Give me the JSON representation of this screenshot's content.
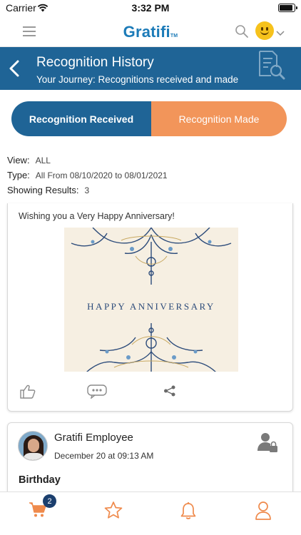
{
  "status_bar": {
    "carrier": "Carrier",
    "time": "3:32 PM"
  },
  "header": {
    "logo_text": "Gratifi",
    "logo_tm": "TM",
    "icons": [
      "menu-icon",
      "search-icon",
      "smiley-icon",
      "chevron-down-icon"
    ]
  },
  "banner": {
    "title": "Recognition History",
    "subtitle": "Your Journey: Recognitions received and made",
    "icons": [
      "back-icon",
      "document-search-icon"
    ]
  },
  "tabs": {
    "received": "Recognition Received",
    "made": "Recognition Made",
    "active": "made"
  },
  "filters": {
    "view_label": "View:",
    "view_value": "ALL",
    "type_label": "Type:",
    "type_value": "All From 08/10/2020 to 08/01/2021",
    "results_label": "Showing Results:",
    "results_value": "3"
  },
  "feed": {
    "card1": {
      "message": "Wishing you a Very Happy Anniversary!",
      "image_text": "HAPPY ANNIVERSARY",
      "actions": [
        "like-icon",
        "comment-icon",
        "share-icon"
      ]
    },
    "card2": {
      "name": "Gratifi Employee",
      "date": "December 20 at 09:13 AM",
      "occasion": "Birthday",
      "icons": [
        "private-user-lock-icon"
      ]
    }
  },
  "bottom_nav": {
    "cart_badge": "2",
    "items": [
      "cart-icon",
      "star-icon",
      "bell-icon",
      "profile-icon"
    ]
  },
  "colors": {
    "brand_blue": "#1f6496",
    "accent_orange": "#f2955a",
    "nav_icon": "#ef8a4c",
    "badge": "#1b3f6e"
  }
}
